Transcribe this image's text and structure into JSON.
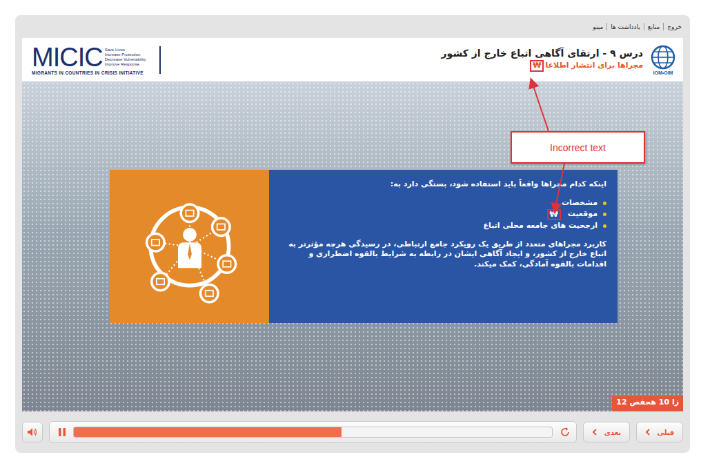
{
  "menu": [
    {
      "label": "خروج"
    },
    {
      "label": "منابع"
    },
    {
      "label": "یادداشت ها"
    },
    {
      "label": "مینو"
    }
  ],
  "logo": {
    "name": "MICIC",
    "taglines": [
      "Save Lives",
      "Increase Protection",
      "Decrease Vulnerability",
      "Improve Response"
    ],
    "subtitle": "MIGRANTS IN COUNTRIES IN CRISIS INITIATIVE"
  },
  "org_logo": {
    "label": "IOM•OIM"
  },
  "lesson": {
    "title": "درس ۹ - ارتقای آگاهی اتباع خارج از کشور",
    "subtitle": "مجراها برای انتشار اطلاعا",
    "broken_glyph": "₩"
  },
  "card": {
    "intro": "اینکه کدام مجراها واقعاً باید استفاده شود، بستگی دارد به:",
    "bullets": [
      {
        "text": "مشخصات",
        "flagged": false,
        "glyph": ""
      },
      {
        "text": "موقعیت",
        "flagged": true,
        "glyph": "₩"
      },
      {
        "text": "ارجحیت های جامعه محلی اتباع",
        "flagged": false,
        "glyph": ""
      }
    ],
    "paragraph": "کاربرد مجراهای متعدد از طریق یک رویکرد جامع ارتباطی، در رسیدگی هرچه مؤثرتر به اتباع خارج از کشور، و ایجاد آگاهی ایشان در رابطه به شرایط بالقوه اضطراری و اقدامات بالقوه آمادگی، کمک میکند."
  },
  "annotation": {
    "label": "Incorrect text"
  },
  "page_counter": "12 زا 10 هحفص",
  "player": {
    "playing": true,
    "progress": 0.56,
    "buttons": [
      {
        "label": "بعدی"
      },
      {
        "label": "قبلی"
      }
    ]
  }
}
